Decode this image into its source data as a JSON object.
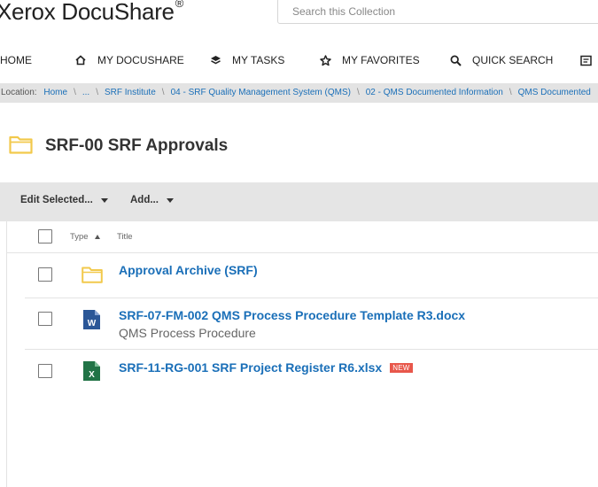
{
  "brand": {
    "name": "Xerox DocuShare",
    "mark": "®"
  },
  "search": {
    "placeholder": "Search this Collection"
  },
  "nav": {
    "home": "HOME",
    "my_docushare": "MY DOCUSHARE",
    "my_tasks": "MY TASKS",
    "my_favorites": "MY FAVORITES",
    "quick_search": "QUICK SEARCH"
  },
  "breadcrumb": {
    "prefix": "Location:",
    "items": [
      "Home",
      "...",
      "SRF Institute",
      "04 - SRF Quality Management System (QMS)",
      "02 - QMS Documented Information",
      "QMS Documented"
    ]
  },
  "page": {
    "title": "SRF-00 SRF Approvals"
  },
  "toolbar": {
    "edit_selected": "Edit Selected...",
    "add": "Add..."
  },
  "list": {
    "col_type": "Type",
    "col_title": "Title",
    "rows": [
      {
        "title": "Approval Archive (SRF)",
        "subtitle": "",
        "icon": "folder-icon"
      },
      {
        "title": "SRF-07-FM-002 QMS Process Procedure Template R3.docx",
        "subtitle": "QMS Process Procedure",
        "icon": "word-icon",
        "icon_letter": "W"
      },
      {
        "title": "SRF-11-RG-001 SRF Project Register R6.xlsx",
        "subtitle": "",
        "icon": "excel-icon",
        "icon_letter": "X",
        "badge": "NEW"
      }
    ]
  },
  "colors": {
    "link": "#1a6fb8",
    "folder": "#f2c94c",
    "word": "#2b5797",
    "excel": "#217346",
    "new_badge": "#e8574b"
  }
}
